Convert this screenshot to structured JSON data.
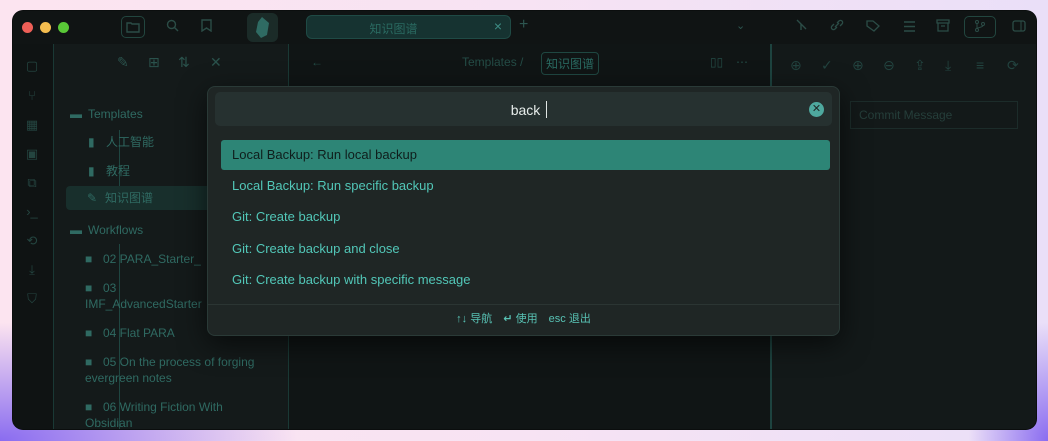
{
  "window": {
    "traffic_lights": {
      "close": "#ee5f57",
      "minimize": "#f4bd4f",
      "maximize": "#59c837"
    },
    "accent": "#2d8576"
  },
  "tabbar": {
    "active_tab": "知识图谱",
    "close_glyph": "×",
    "add_glyph": "+",
    "chevron_glyph": "⌄"
  },
  "explorer": {
    "tree": [
      {
        "label": "Templates",
        "type": "folder"
      },
      {
        "label": "人工智能",
        "type": "file"
      },
      {
        "label": "教程",
        "type": "file"
      },
      {
        "label": "知识图谱",
        "type": "file-active"
      },
      {
        "label": "Workflows",
        "type": "folder"
      },
      {
        "label": "02 PARA_Starter_",
        "type": "folder"
      },
      {
        "label": "03",
        "type": "folder"
      },
      {
        "label": "IMF_AdvancedStarter",
        "type": "text"
      },
      {
        "label": "04 Flat PARA",
        "type": "folder"
      },
      {
        "label": "05 On the process of forging",
        "type": "folder"
      },
      {
        "label": "evergreen notes",
        "type": "text"
      },
      {
        "label": "06 Writing Fiction With",
        "type": "folder"
      },
      {
        "label": "Obsidian",
        "type": "text"
      }
    ]
  },
  "editor": {
    "breadcrumb_parent": "Templates /",
    "breadcrumb_current": "知识图谱"
  },
  "git_panel": {
    "commit_placeholder": "Commit Message"
  },
  "palette": {
    "query": "back",
    "results": [
      "Local Backup: Run local backup",
      "Local Backup: Run specific backup",
      "Git: Create backup",
      "Git: Create backup and close",
      "Git: Create backup with specific message"
    ],
    "selected_index": 0,
    "footer": {
      "navigate_key": "↑↓",
      "navigate_label": "导航",
      "use_key": "↵",
      "use_label": "使用",
      "escape_key": "esc",
      "escape_label": "退出"
    }
  }
}
